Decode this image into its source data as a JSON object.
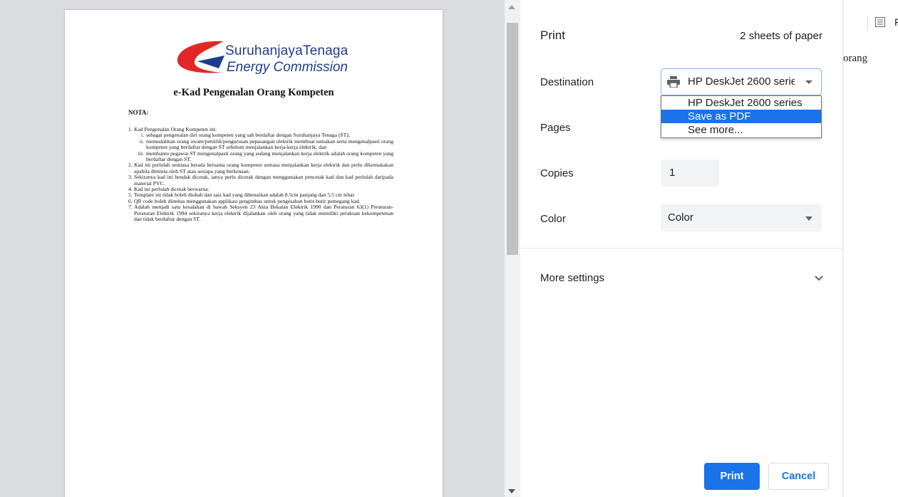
{
  "document": {
    "logo_line1": "SuruhanjayaTenaga",
    "logo_line2": "Energy Commission",
    "title": "e-Kad Pengenalan Orang Kompeten",
    "nota": "NOTA:",
    "notes": [
      {
        "num": "1.",
        "text": "Kad Pengenalan Orang Kompeten ini:",
        "subs": [
          {
            "num": "i.",
            "text": "sebagai pengenalan diri orang kompeten yang sah berdaftar dengan Suruhanjaya Tenaga (ST);"
          },
          {
            "num": "ii.",
            "text": "memudahkan orang awam/pemilik/pengurusan pepasangan elektrik membuat semakan serta mengenalpasti orang kompeten yang berdaftar dengan ST sebelum menjalankan kerja-kerja elektrik; dan"
          },
          {
            "num": "iii.",
            "text": "membantu pegawai ST mengenalpasti orang yang sedang menjalankan kerja elektrik adalah orang kompeten yang berdaftar dengan ST."
          }
        ]
      },
      {
        "num": "2.",
        "text": "Kad ini perlulah sentiasa berada bersama orang kompeten semasa menjalankan kerja elektrik dan perlu dikemukakan apabila diminta oleh ST atau sesiapa yang berkenaan."
      },
      {
        "num": "3.",
        "text": "Sekiranya kad ini hendak dicetak, ianya perlu dicetak dengan menggunakan pencetak kad dan kad perlulah daripada material PVC."
      },
      {
        "num": "4.",
        "text": "Kad ini perlulah dicetak berwarna."
      },
      {
        "num": "5.",
        "text": "Template ini tidak boleh diubah dan saiz kad yang dibenarkan adalah 8.5cm panjang dan 5.5 cm lebar."
      },
      {
        "num": "6.",
        "text": "QR code boleh diimbas menggunakan applikasi pengimbas untuk pengesahan butir-butir pemegang kad."
      },
      {
        "num": "7.",
        "text": "Adalah menjadi satu kesalahan di bawah Seksyen 23 Akta Bekalan Elektrik 1990 dan Peraturan 63(1) Peraturan-Peraturan Elektrik 1994 sekiranya kerja elektrik dijalankan oleh orang yang tidak memiliki perakuan kekompetenan dan tidak berdaftar dengan ST."
      }
    ]
  },
  "print": {
    "title": "Print",
    "sheets": "2 sheets of paper",
    "destination_label": "Destination",
    "destination_value": "HP DeskJet 2600 series",
    "destination_options": [
      "HP DeskJet 2600 series",
      "Save as PDF",
      "See more..."
    ],
    "destination_highlighted": 1,
    "pages_label": "Pages",
    "copies_label": "Copies",
    "copies_value": "1",
    "color_label": "Color",
    "color_value": "Color",
    "more_settings": "More settings",
    "print_button": "Print",
    "cancel_button": "Cancel"
  },
  "background": {
    "text": "orang",
    "edge_letter": "F"
  },
  "colors": {
    "accent": "#1a73e8",
    "logo_red": "#e32626",
    "logo_blue": "#1f3c8c"
  }
}
